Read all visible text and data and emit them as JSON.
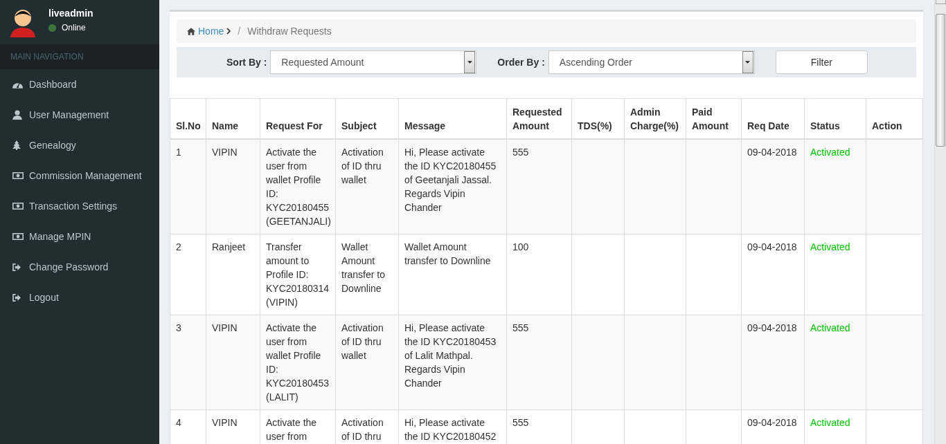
{
  "user": {
    "name": "liveadmin",
    "status": "Online",
    "online": true
  },
  "sidebar": {
    "header": "MAIN NAVIGATION",
    "items": [
      {
        "label": "Dashboard",
        "kind": "dashboard",
        "selected": false
      },
      {
        "label": "User Management",
        "kind": "user",
        "selected": false
      },
      {
        "label": "Genealogy",
        "kind": "tree",
        "selected": false
      },
      {
        "label": "Commission Management",
        "kind": "money",
        "selected": false
      },
      {
        "label": "Transaction Settings",
        "kind": "money",
        "selected": false
      },
      {
        "label": "Manage MPIN",
        "kind": "money",
        "selected": false
      },
      {
        "label": "Change Password",
        "kind": "signout",
        "selected": false
      },
      {
        "label": "Logout",
        "kind": "signout",
        "selected": false
      }
    ]
  },
  "breadcrumb": {
    "home": "Home",
    "separator": "/",
    "current": "Withdraw Requests"
  },
  "filters": {
    "sort_label": "Sort By :",
    "sort_value": "Requested Amount",
    "order_label": "Order By :",
    "order_value": "Ascending Order",
    "button": "Filter"
  },
  "table": {
    "columns": [
      "Sl.No",
      "Name",
      "Request For",
      "Subject",
      "Message",
      "Requested Amount",
      "TDS(%)",
      "Admin Charge(%)",
      "Paid Amount",
      "Req Date",
      "Status",
      "Action"
    ],
    "rows": [
      [
        "1",
        "VIPIN",
        "Activate the user from wallet Profile ID: KYC20180455 (GEETANJALI)",
        "Activation of ID thru wallet",
        "Hi, Please activate the ID KYC20180455 of Geetanjali Jassal. Regards Vipin Chander",
        "555",
        "",
        "",
        "",
        "09-04-2018",
        "Activated",
        ""
      ],
      [
        "2",
        "Ranjeet",
        "Transfer amount to Profile ID: KYC20180314 (VIPIN)",
        "Wallet Amount transfer to Downline",
        "Wallet Amount transfer to Downline",
        "100",
        "",
        "",
        "",
        "09-04-2018",
        "Activated",
        ""
      ],
      [
        "3",
        "VIPIN",
        "Activate the user from wallet Profile ID: KYC20180453 (LALIT)",
        "Activation of ID thru wallet",
        "Hi, Please activate the ID KYC20180453 of Lalit Mathpal. Regards Vipin Chander",
        "555",
        "",
        "",
        "",
        "09-04-2018",
        "Activated",
        ""
      ],
      [
        "4",
        "VIPIN",
        "Activate the user from",
        "Activation of ID thru",
        "Hi, Please activate the ID KYC20180452",
        "555",
        "",
        "",
        "",
        "09-04-2018",
        "Activated",
        ""
      ]
    ]
  }
}
